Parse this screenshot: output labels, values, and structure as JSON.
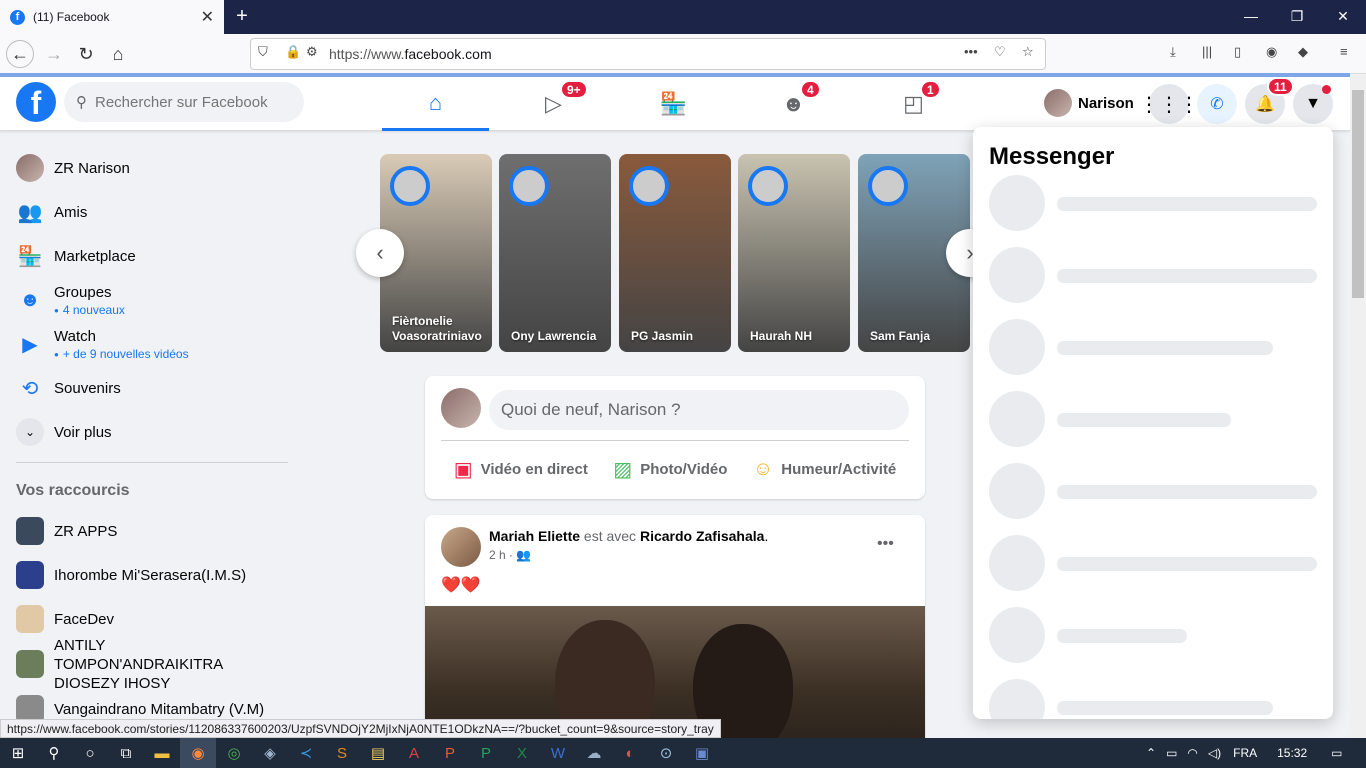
{
  "browser": {
    "tab_title": "(11) Facebook",
    "tab_close": "✕",
    "new_tab": "+",
    "url_prefix": "https://www.",
    "url_domain": "facebook.com",
    "url_more": "•••",
    "status_url": "https://www.facebook.com/stories/112086337600203/UzpfSVNDOjY2MjIxNjA0NTE1ODkzNA==/?bucket_count=9&source=story_tray"
  },
  "header": {
    "search_placeholder": "Rechercher sur Facebook",
    "profile_name": "Narison",
    "badges": {
      "watch": "9+",
      "groups": "4",
      "gaming": "1",
      "notifications": "11"
    }
  },
  "sidebar": {
    "items": [
      {
        "label": "ZR Narison",
        "sub": ""
      },
      {
        "label": "Amis",
        "sub": ""
      },
      {
        "label": "Marketplace",
        "sub": ""
      },
      {
        "label": "Groupes",
        "sub": "4 nouveaux"
      },
      {
        "label": "Watch",
        "sub": "+ de 9 nouvelles vidéos"
      },
      {
        "label": "Souvenirs",
        "sub": ""
      },
      {
        "label": "Voir plus",
        "sub": ""
      }
    ],
    "shortcuts_title": "Vos raccourcis",
    "shortcuts": [
      {
        "label": "ZR APPS"
      },
      {
        "label": "Ihorombe Mi'Serasera(I.M.S)"
      },
      {
        "label": "FaceDev"
      },
      {
        "label": "ANTILY TOMPON'ANDRAIKITRA DIOSEZY IHOSY"
      },
      {
        "label": "Vangaindrano Mitambatry (V.M)"
      }
    ]
  },
  "stories": [
    {
      "name": "Fièrtonelie Voasoratriniavo",
      "color": "#d9cbb6"
    },
    {
      "name": "Ony Lawrencia",
      "color": "#6f6f6f"
    },
    {
      "name": "PG Jasmin",
      "color": "#8a5a3c"
    },
    {
      "name": "Haurah NH",
      "color": "#c9c3b0"
    },
    {
      "name": "Sam Fanja",
      "color": "#7fa3b8"
    }
  ],
  "composer": {
    "placeholder": "Quoi de neuf, Narison ?",
    "actions": [
      "Vidéo en direct",
      "Photo/Vidéo",
      "Humeur/Activité"
    ]
  },
  "post": {
    "author": "Mariah Eliette",
    "with_text": " est avec ",
    "tagged": "Ricardo Zafisahala",
    "period": ".",
    "time": "2 h ·",
    "content": "❤️❤️",
    "more": "•••"
  },
  "messenger": {
    "title": "Messenger"
  },
  "taskbar": {
    "lang": "FRA",
    "time": "15:32"
  }
}
